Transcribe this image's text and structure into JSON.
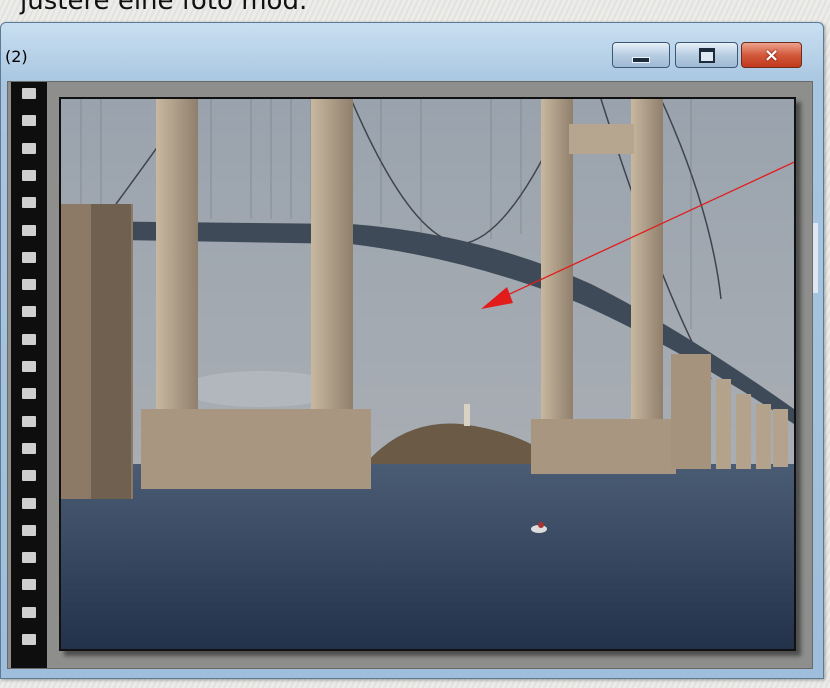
{
  "page": {
    "caption": "justere eine foto mod."
  },
  "window": {
    "title": "(2)",
    "buttons": {
      "minimize": "minimize-button",
      "maximize": "maximize-button",
      "close": "close-button",
      "close_glyph": "×"
    }
  },
  "photo": {
    "subject": "bridge"
  },
  "annotation": {
    "arrow_color": "#e21b1b"
  },
  "colors": {
    "window_chrome": "#a9c6e0",
    "close_red": "#d2593c",
    "film": "#0e0e0e"
  }
}
